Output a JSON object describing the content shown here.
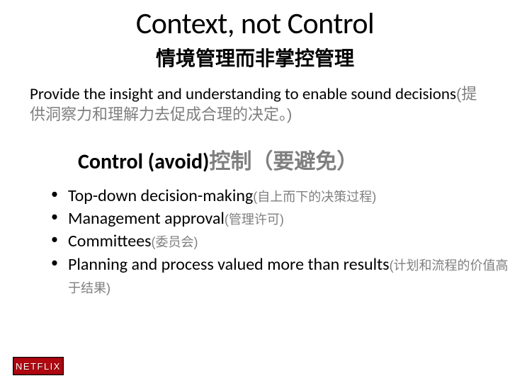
{
  "title": {
    "en": "Context, not Control",
    "zh": "情境管理而非掌控管理"
  },
  "subtitle": {
    "en": "Provide the insight and understanding to enable sound decisions",
    "zh": "(提供洞察力和理解力去促成合理的决定。)"
  },
  "section": {
    "en": "Control (avoid)",
    "zh": "控制（要避免）"
  },
  "bullets": [
    {
      "en": "Top-down decision-making",
      "zh": "(自上而下的决策过程)"
    },
    {
      "en": "Management approval",
      "zh": "(管理许可)"
    },
    {
      "en": "Committees",
      "zh": "(委员会)"
    },
    {
      "en": "Planning and process valued more than results",
      "zh": "(计划和流程的价值高于结果)"
    }
  ],
  "logo": {
    "text": "NETFLIX"
  }
}
